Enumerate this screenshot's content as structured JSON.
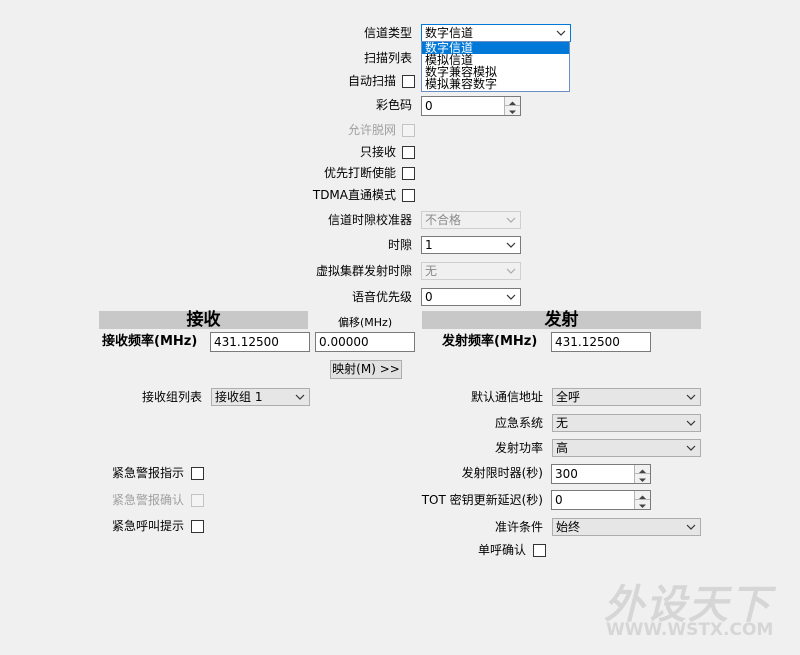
{
  "top": {
    "channel_type": {
      "label": "信道类型",
      "value": "数字信道",
      "options": [
        "数字信道",
        "模拟信道",
        "数字兼容模拟",
        "模拟兼容数字"
      ]
    },
    "scan_list": {
      "label": "扫描列表"
    },
    "auto_scan": {
      "label": "自动扫描"
    },
    "color_code": {
      "label": "彩色码",
      "value": "0"
    },
    "allow_offnet": {
      "label": "允许脱网"
    },
    "rx_only": {
      "label": "只接收"
    },
    "priority_interrupt": {
      "label": "优先打断使能"
    },
    "tdma_direct": {
      "label": "TDMA直通模式"
    },
    "slot_calibrator": {
      "label": "信道时隙校准器",
      "value": "不合格"
    },
    "slot": {
      "label": "时隙",
      "value": "1"
    },
    "virtual_cluster_slot": {
      "label": "虚拟集群发射时隙",
      "value": "无"
    },
    "voice_priority": {
      "label": "语音优先级",
      "value": "0"
    }
  },
  "receive": {
    "header": "接收",
    "freq_label": "接收频率(MHz)",
    "freq_value": "431.12500",
    "group_list_label": "接收组列表",
    "group_list_value": "接收组 1",
    "emergency_alarm_indicate": "紧急警报指示",
    "emergency_alarm_confirm": "紧急警报确认",
    "emergency_call_prompt": "紧急呼叫提示"
  },
  "offset": {
    "label": "偏移(MHz)",
    "value": "0.00000",
    "map_button": "映射(M) >>"
  },
  "transmit": {
    "header": "发射",
    "freq_label": "发射频率(MHz)",
    "freq_value": "431.12500",
    "default_contact_label": "默认通信地址",
    "default_contact_value": "全呼",
    "emergency_system_label": "应急系统",
    "emergency_system_value": "无",
    "power_label": "发射功率",
    "power_value": "高",
    "tx_timer_label": "发射限时器(秒)",
    "tx_timer_value": "300",
    "tot_rekey_label": "TOT 密钥更新延迟(秒)",
    "tot_rekey_value": "0",
    "permit_label": "准许条件",
    "permit_value": "始终",
    "single_call_confirm": "单呼确认"
  },
  "watermark": {
    "text_cn": "外设天下",
    "text_en": "WWW.WSTX.COM"
  },
  "colors": {
    "accent": "#0078d7",
    "band": "#c8c8c8",
    "background": "#f0f0f0"
  }
}
